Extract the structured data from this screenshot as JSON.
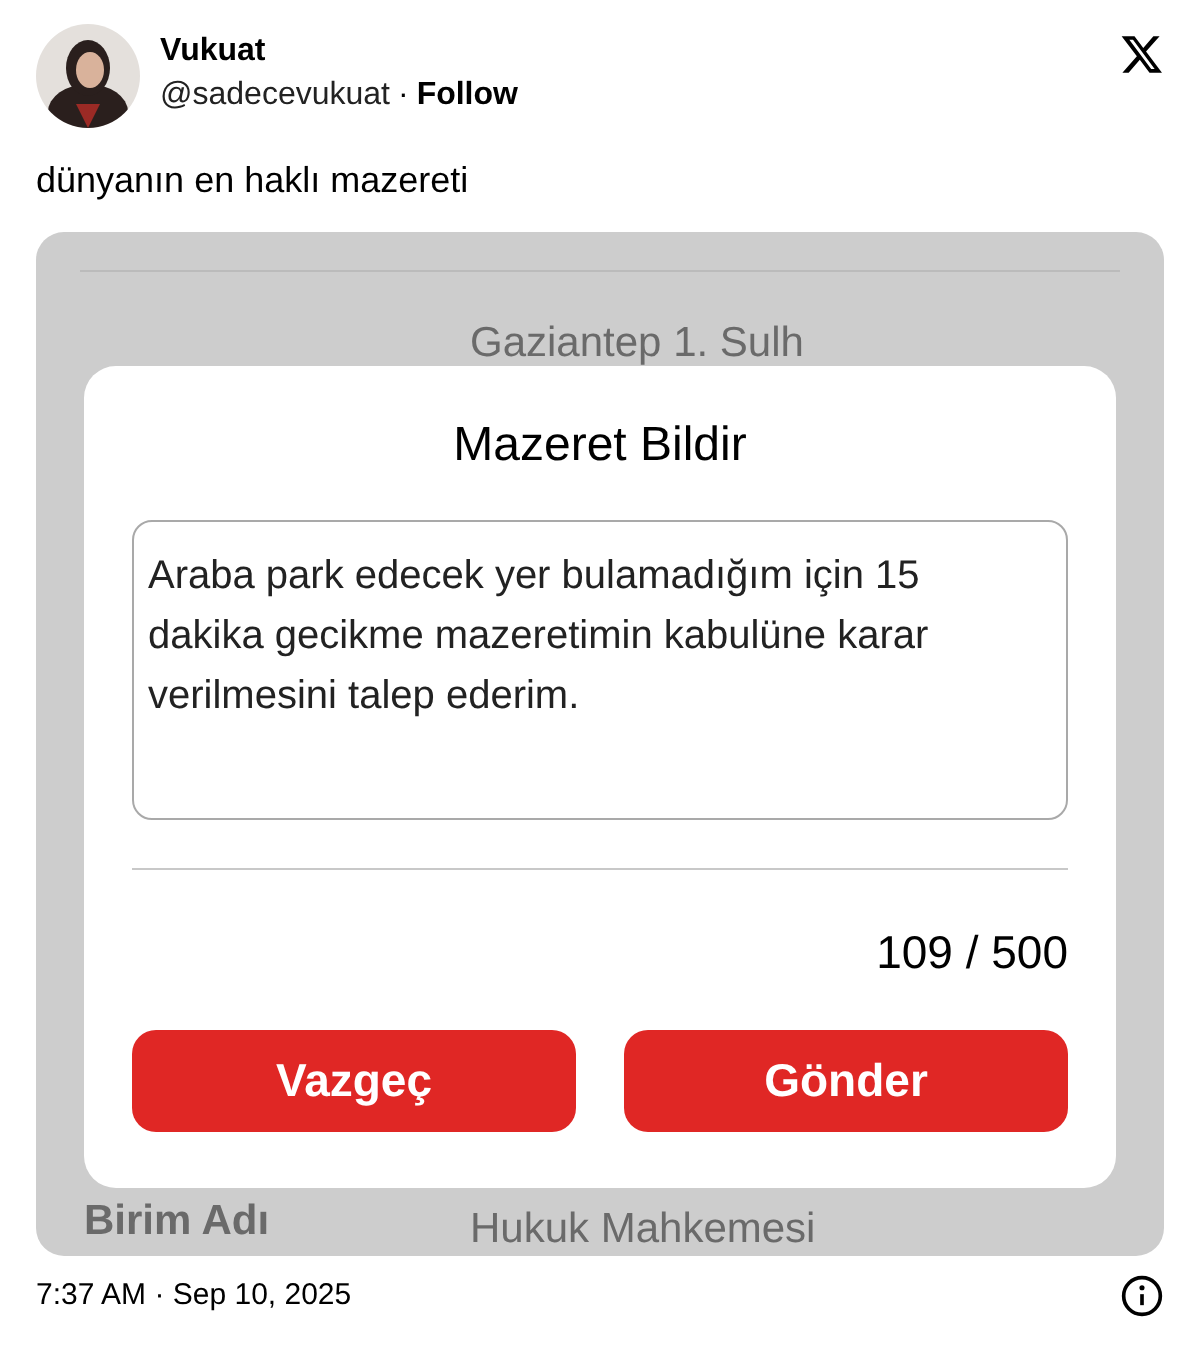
{
  "author": {
    "name": "Vukuat",
    "handle": "@sadecevukuat",
    "separator": "·",
    "follow": "Follow"
  },
  "text": "dünyanın en haklı mazereti",
  "screenshot": {
    "background_value": "Gaziantep 1. Sulh",
    "bottom_label": "Birim Adı",
    "bottom_value": "Hukuk Mahkemesi",
    "dialog": {
      "title": "Mazeret Bildir",
      "message": "Araba park edecek yer bulamadığım için 15 dakika gecikme mazeretimin kabulüne karar verilmesini talep ederim.",
      "counter": "109 / 500",
      "buttons": [
        "Vazgeç",
        "Gönder"
      ]
    }
  },
  "timestamp": "7:37 AM · Sep 10, 2025"
}
